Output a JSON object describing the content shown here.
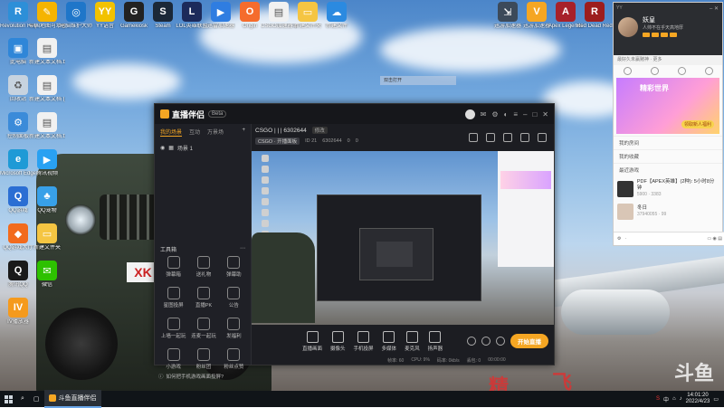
{
  "desktop_icons_top": [
    {
      "label": "Revolution Helpers",
      "color": "#2d8fd8",
      "glyph": "R"
    },
    {
      "label": "中国地图可填色",
      "color": "#f5b400",
      "glyph": "✎"
    },
    {
      "label": "电脑维护大师",
      "color": "#1f76c9",
      "glyph": "◎"
    },
    {
      "label": "YY语音",
      "color": "#f2c200",
      "glyph": "YY"
    },
    {
      "label": "Gamekiosk",
      "color": "#222222",
      "glyph": "G"
    },
    {
      "label": "Steam",
      "color": "#1b2838",
      "glyph": "S"
    },
    {
      "label": "LOL英雄联盟",
      "color": "#1c2a5a",
      "glyph": "L"
    },
    {
      "label": "迅雷加速器",
      "color": "#2f7de1",
      "glyph": "▶"
    },
    {
      "label": "Origin",
      "color": "#f56c2d",
      "glyph": "O"
    },
    {
      "label": "CSGO加速器.docx",
      "color": "#f1f1f1",
      "glyph": "▤"
    },
    {
      "label": "新建文件夹",
      "color": "#f5c542",
      "glyph": "▭"
    },
    {
      "label": "新建文件",
      "color": "#2b8ae0",
      "glyph": "☁"
    }
  ],
  "desktop_icons_top_right": [
    {
      "label": "迅游加速器",
      "color": "#3c4a5a",
      "glyph": "⇲"
    },
    {
      "label": "迅游加速器",
      "color": "#f5a623",
      "glyph": "V"
    },
    {
      "label": "Apex Legends",
      "color": "#a7212a",
      "glyph": "A"
    },
    {
      "label": "Red Dead Redemption",
      "color": "#9d1d1d",
      "glyph": "R"
    }
  ],
  "desktop_icons_left": [
    {
      "label": "此电脑",
      "color": "#2f86d8",
      "glyph": "▣"
    },
    {
      "label": "新建文本文档.txt",
      "color": "#f1f1f1",
      "glyph": "▤"
    },
    {
      "label": "回收站",
      "color": "#c7d3df",
      "glyph": "♻"
    },
    {
      "label": "新建文本文档 (2).txt",
      "color": "#f1f1f1",
      "glyph": "▤"
    },
    {
      "label": "控制面板",
      "color": "#3b8bd9",
      "glyph": "⚙"
    },
    {
      "label": "新建文本文档.txt",
      "color": "#f1f1f1",
      "glyph": "▤"
    },
    {
      "label": "Microsoft Edge",
      "color": "#1e9ad6",
      "glyph": "e"
    },
    {
      "label": "腾讯视频",
      "color": "#29a1f2",
      "glyph": "▶"
    },
    {
      "label": "QQ游戏",
      "color": "#2b6ed3",
      "glyph": "Q"
    },
    {
      "label": "QQ宠物",
      "color": "#38a0e8",
      "glyph": "♣"
    },
    {
      "label": "QQ游戏大厅",
      "color": "#f26b1d",
      "glyph": "◆"
    },
    {
      "label": "新建文件夹",
      "color": "#f5c542",
      "glyph": "▭"
    },
    {
      "label": "腾讯QQ",
      "color": "#1a1a1a",
      "glyph": "Q"
    },
    {
      "label": "微信",
      "color": "#2dc100",
      "glyph": "✉"
    },
    {
      "label": "IV播放器",
      "color": "#f59a1d",
      "glyph": "IV"
    }
  ],
  "desktop_tooltip": "双击打开",
  "obs": {
    "logo": "直播伴侣",
    "beta": "Beta",
    "left_tabs": [
      "我的场景",
      "互动",
      "万景场"
    ],
    "scene_name": "场景 1",
    "toolbox_title": "工具箱",
    "tools": [
      {
        "label": "弹幕箱"
      },
      {
        "label": "送礼物"
      },
      {
        "label": "弹幕助"
      },
      {
        "label": "星图投屏"
      },
      {
        "label": "直播PK"
      },
      {
        "label": "公告"
      },
      {
        "label": "上墙一起玩"
      },
      {
        "label": "连麦一起玩"
      },
      {
        "label": "发福利"
      },
      {
        "label": "小游戏"
      },
      {
        "label": "粉丝团"
      },
      {
        "label": "粉丝点赞"
      }
    ],
    "tip_text": "如何把手机游戏画面投屏?",
    "stream_title": "CSGO | | | 6302644",
    "stream_tag": "修改",
    "sub_pill": "CSGO · 开播面板",
    "sub_meta": [
      "ID 21",
      "6302644",
      "0",
      "0"
    ],
    "bottom_items": [
      {
        "label": "直播画面"
      },
      {
        "label": "摄像头"
      },
      {
        "label": "手机投屏"
      },
      {
        "label": "多媒体"
      },
      {
        "label": "麦克风"
      },
      {
        "label": "扬声器"
      }
    ],
    "start_button": "开始直播",
    "status_items": [
      "帧率: 60",
      "CPU: 9%",
      "码率: 0kb/s",
      "丢包: 0",
      "00:00:00"
    ]
  },
  "side_panel": {
    "top_label": "YY",
    "name": "妖皇",
    "desc": "人帅不在乎天高地厚",
    "hint": "最好久未赢赌神 · 更多",
    "banner_title": "精彩世界",
    "banner_btn": "领取新人福利",
    "section_1": "我的房间",
    "section_2": "我的收藏",
    "section_3": "最近游戏",
    "rows": [
      {
        "title": "PDF【APEX英雄】(2种): 5小时8分钟",
        "sub": "5900 · 3383"
      },
      {
        "title": "冬日",
        "sub": "37940055 · 99"
      }
    ],
    "footer": "·"
  },
  "taskbar": {
    "search": "⌕",
    "app_label": "斗鱼直播伴侣",
    "time": "14:01:20",
    "date": "2022/4/23",
    "ime": "中"
  },
  "ground_texts": [
    "飞",
    "精",
    "斗鱼"
  ],
  "plate_text": "XK"
}
